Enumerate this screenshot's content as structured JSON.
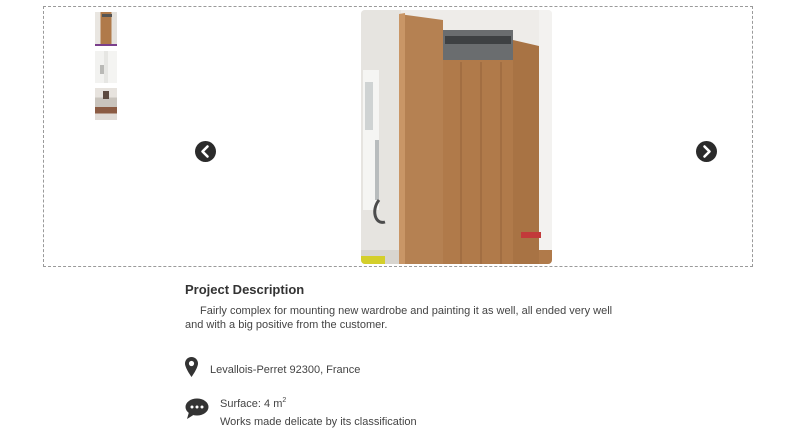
{
  "gallery": {
    "thumbnails": [
      {
        "label": "wardrobe photo 1",
        "active": true
      },
      {
        "label": "wardrobe photo 2",
        "active": false
      },
      {
        "label": "wardrobe photo 3",
        "active": false
      }
    ],
    "prev_icon": "chevron-left-circle-icon",
    "next_icon": "chevron-right-circle-icon"
  },
  "project": {
    "title": "Project Description",
    "description": "Fairly complex for mounting new wardrobe and painting it as well, all ended very well and with a big positive from the customer."
  },
  "location": {
    "icon": "map-pin-icon",
    "text": "Levallois-Perret 92300, France"
  },
  "surface": {
    "icon": "speech-bubble-icon",
    "label": "Surface: 4 m",
    "unit_exponent": "2",
    "note": "Works made delicate by its classification"
  },
  "colors": {
    "nav_button": "#2b2b2b",
    "active_thumb_border": "#7a3f8c",
    "wardrobe": "#b07a4a"
  }
}
